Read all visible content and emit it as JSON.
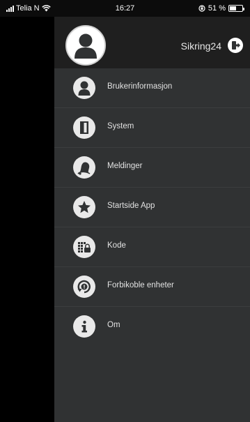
{
  "status_bar": {
    "carrier": "Telia N",
    "time": "16:27",
    "battery_text": "51 %",
    "battery_level": 0.51
  },
  "drawer": {
    "brand": "Sikring24",
    "avatar_icon": "user-avatar-icon",
    "logout_icon": "logout-icon",
    "menu": [
      {
        "label": "Brukerinformasjon",
        "icon": "user-icon"
      },
      {
        "label": "System",
        "icon": "door-icon"
      },
      {
        "label": "Meldinger",
        "icon": "bell-icon"
      },
      {
        "label": "Startside App",
        "icon": "star-icon"
      },
      {
        "label": "Kode",
        "icon": "keypad-lock-icon"
      },
      {
        "label": "Forbikoble enheter",
        "icon": "bypass-icon"
      },
      {
        "label": "Om",
        "icon": "info-icon"
      }
    ]
  },
  "colors": {
    "drawer_bg": "#303233",
    "header_bg": "#1f1f1f",
    "icon_bg": "#e9e9e9",
    "icon_fg": "#303233",
    "text": "#e2e2e2"
  }
}
